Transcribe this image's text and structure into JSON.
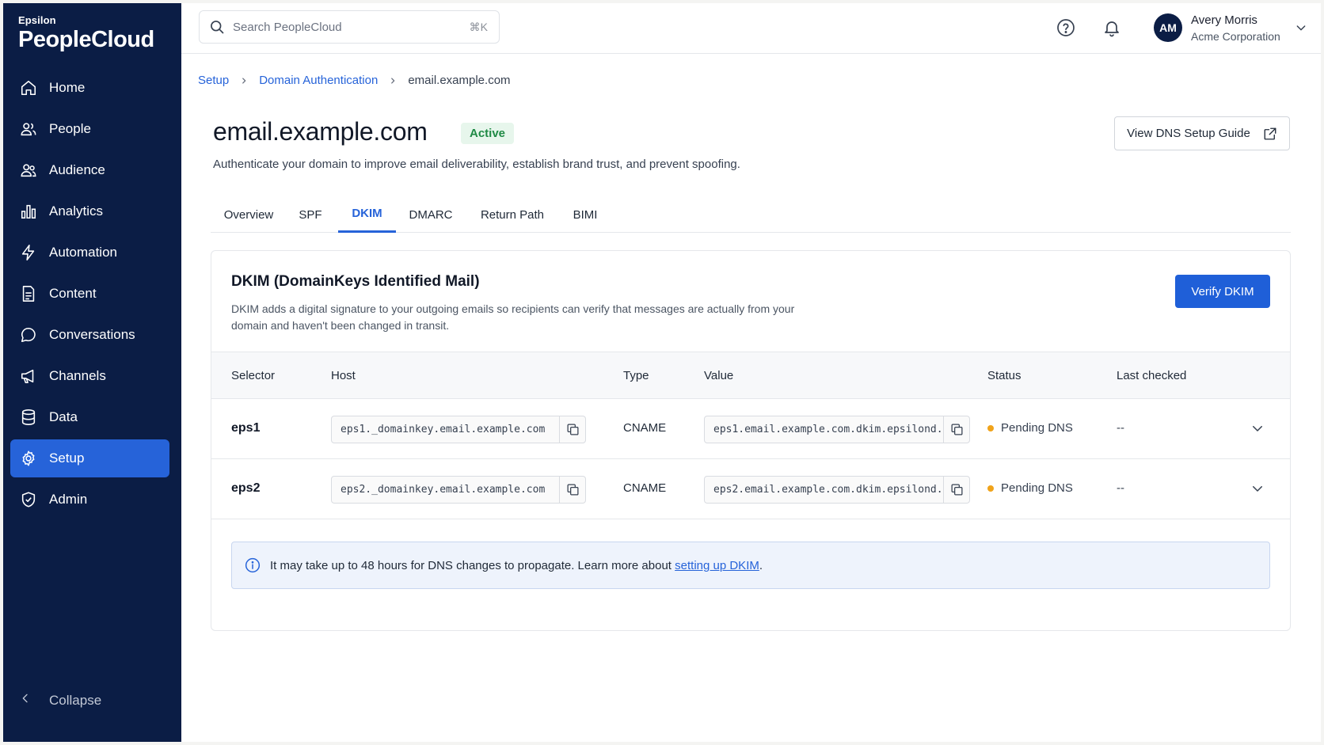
{
  "brand": {
    "small": "Epsilon",
    "name": "PeopleCloud"
  },
  "sidebar": {
    "items": [
      {
        "label": "Home",
        "icon": "home-icon"
      },
      {
        "label": "People",
        "icon": "people-icon"
      },
      {
        "label": "Audience",
        "icon": "audience-icon"
      },
      {
        "label": "Analytics",
        "icon": "analytics-icon"
      },
      {
        "label": "Automation",
        "icon": "bolt-icon"
      },
      {
        "label": "Content",
        "icon": "document-icon"
      },
      {
        "label": "Conversations",
        "icon": "chat-icon"
      },
      {
        "label": "Channels",
        "icon": "megaphone-icon"
      },
      {
        "label": "Data",
        "icon": "database-icon"
      },
      {
        "label": "Setup",
        "icon": "gear-icon",
        "active": true
      },
      {
        "label": "Admin",
        "icon": "shield-icon"
      }
    ],
    "collapse_label": "Collapse"
  },
  "topbar": {
    "search_placeholder": "Search PeopleCloud",
    "search_shortcut": "⌘K",
    "user": {
      "initials": "AM",
      "name": "Avery Morris",
      "org": "Acme Corporation"
    }
  },
  "breadcrumb": {
    "items": [
      "Setup",
      "Domain Authentication"
    ],
    "current": "email.example.com"
  },
  "page": {
    "title": "email.example.com",
    "status": "Active",
    "subtitle": "Authenticate your domain to improve email deliverability, establish brand trust, and prevent spoofing.",
    "guide_button": "View DNS Setup Guide"
  },
  "tabs": [
    {
      "label": "Overview"
    },
    {
      "label": "SPF"
    },
    {
      "label": "DKIM",
      "active": true
    },
    {
      "label": "DMARC"
    },
    {
      "label": "Return Path"
    },
    {
      "label": "BIMI"
    }
  ],
  "dkim": {
    "title": "DKIM (DomainKeys Identified Mail)",
    "description": "DKIM adds a digital signature to your outgoing emails so recipients can verify that messages are actually from your domain and haven't been changed in transit.",
    "verify_button": "Verify DKIM",
    "columns": [
      "Selector",
      "Host",
      "Type",
      "Value",
      "Status",
      "Last checked"
    ],
    "rows": [
      {
        "selector": "eps1",
        "host": "eps1._domainkey.email.example.com",
        "type": "CNAME",
        "value": "eps1.email.example.com.dkim.epsilond...",
        "status": "Pending DNS",
        "last_checked": "--"
      },
      {
        "selector": "eps2",
        "host": "eps2._domainkey.email.example.com",
        "type": "CNAME",
        "value": "eps2.email.example.com.dkim.epsilond...",
        "status": "Pending DNS",
        "last_checked": "--"
      }
    ],
    "info_text": "It may take up to 48 hours for DNS changes to propagate. Learn more about ",
    "info_link": "setting up DKIM",
    "info_suffix": "."
  },
  "colors": {
    "sidebar_bg": "#0b1d45",
    "accent": "#2663d9",
    "active_badge": "#1f8a45",
    "pending_dot": "#f0a31a"
  }
}
